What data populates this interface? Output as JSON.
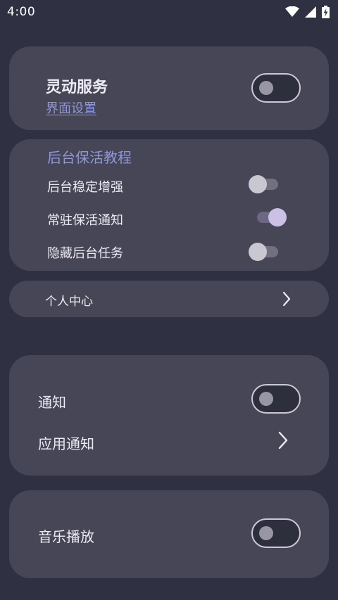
{
  "status_bar": {
    "time": "4:00",
    "icons": [
      "wifi-icon",
      "signal-icon",
      "battery-charging-icon"
    ]
  },
  "card_dynamic": {
    "title": "灵动服务",
    "link": "界面设置",
    "switch_on": false
  },
  "card_background": {
    "header": "后台保活教程",
    "items": [
      {
        "label": "后台稳定增强",
        "on": false
      },
      {
        "label": "常驻保活通知",
        "on": true
      },
      {
        "label": "隐藏后台任务",
        "on": false
      }
    ]
  },
  "personal_center": {
    "label": "个人中心"
  },
  "card_notify": {
    "notify_label": "通知",
    "notify_on": false,
    "app_notify_label": "应用通知"
  },
  "card_music": {
    "label": "音乐播放",
    "switch_on": false
  },
  "colors": {
    "background": "#2f3142",
    "card": "#464657",
    "link": "#8f97d8",
    "switch_on_thumb": "#cbc1e6"
  }
}
